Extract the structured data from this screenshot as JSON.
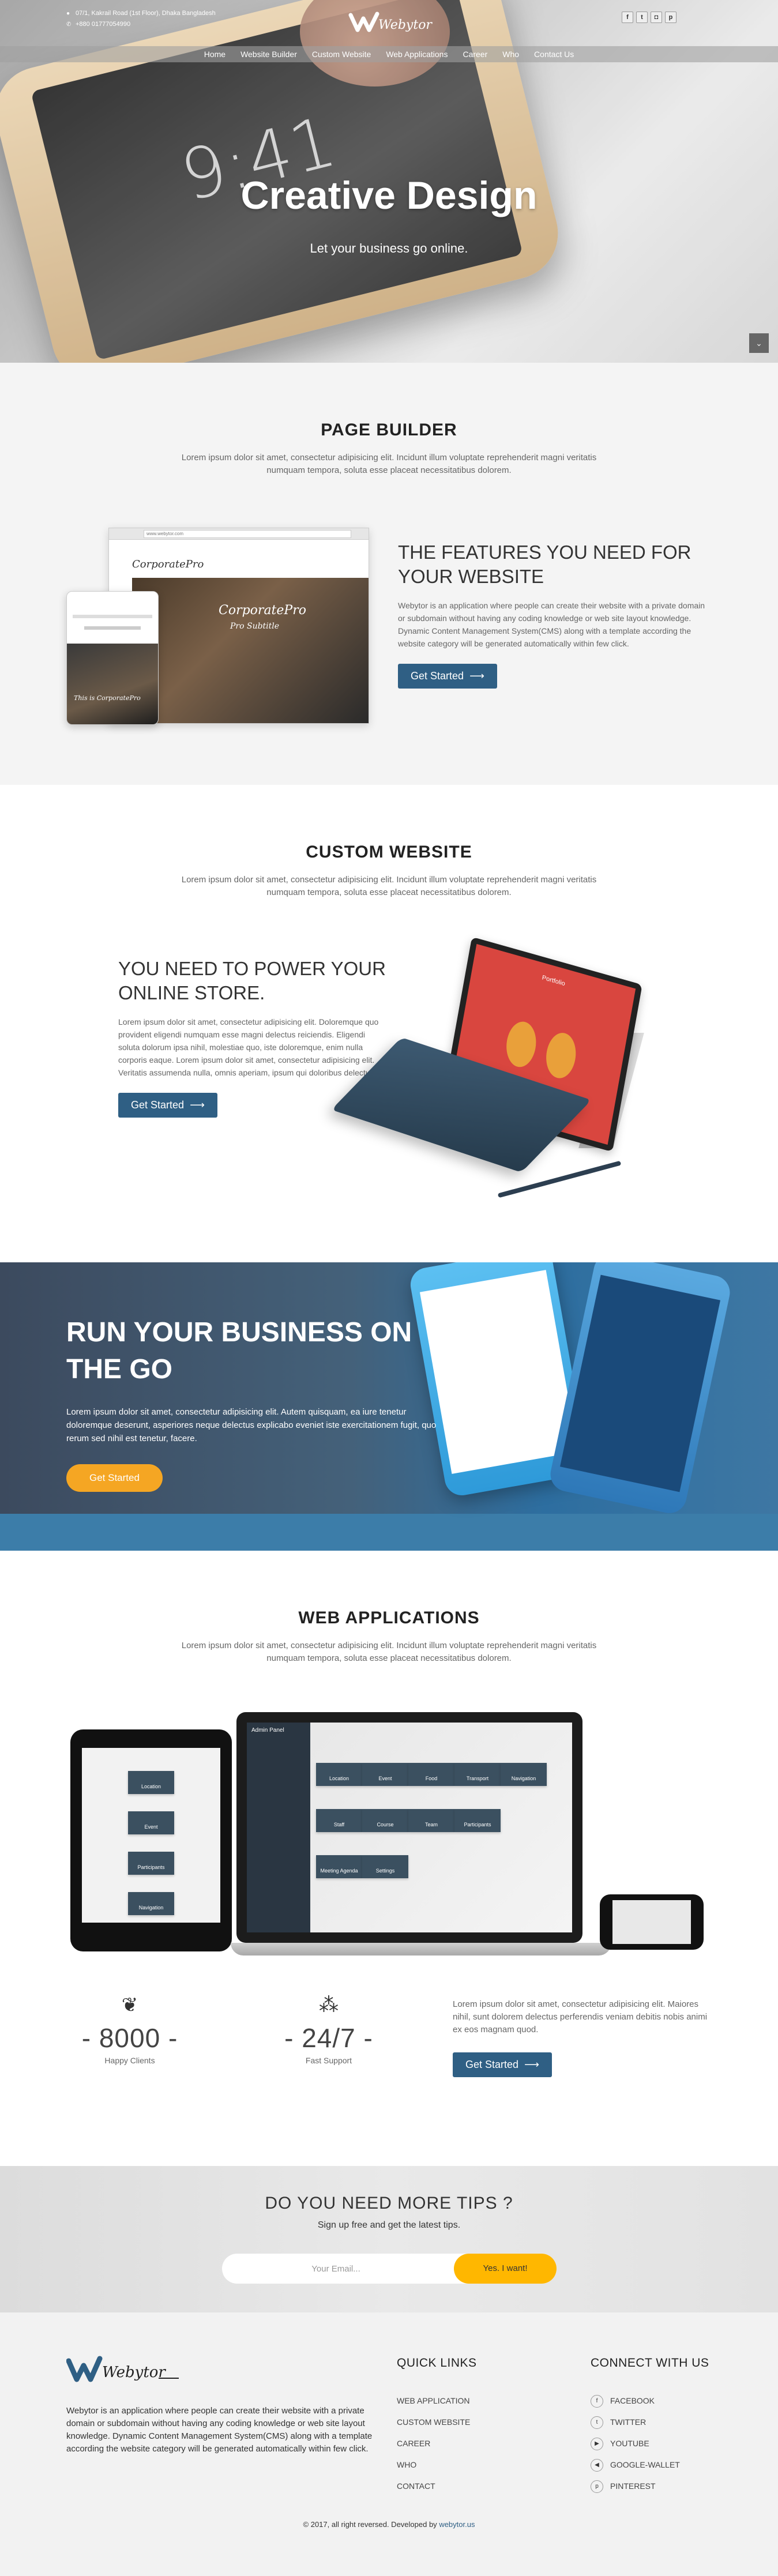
{
  "topbar": {
    "address": "07/1, Kakrail Road (1st Floor), Dhaka Bangladesh",
    "phone": "+880 01777054990",
    "socials": [
      {
        "icon": "facebook-icon",
        "glyph": "f"
      },
      {
        "icon": "twitter-icon",
        "glyph": "t"
      },
      {
        "icon": "instagram-icon",
        "glyph": "◘"
      },
      {
        "icon": "pinterest-icon",
        "glyph": "p"
      }
    ]
  },
  "brand": {
    "name": "Webytor"
  },
  "nav": [
    "Home",
    "Website Builder",
    "Custom Website",
    "Web Applications",
    "Career",
    "Who",
    "Contact Us"
  ],
  "hero": {
    "title": "Creative Design",
    "subtitle": "Let your business go online."
  },
  "page_builder": {
    "title": "PAGE BUILDER",
    "lead": "Lorem ipsum dolor sit amet, consectetur adipisicing elit. Incidunt illum voluptate reprehenderit magni veritatis numquam tempora, soluta esse placeat necessitatibus dolorem.",
    "feature_heading": "THE FEATURES YOU NEED FOR YOUR WEBSITE",
    "feature_text": "Webytor is an application where people can create their website with a private domain or subdomain without having any coding knowledge or web site layout knowledge. Dynamic Content Management System(CMS) along with a template according the website category will be generated automatically within few click.",
    "button": "Get Started",
    "mock_url": "www.webytor.com",
    "mock_brand": "CorporatePro",
    "mock_tagline": "Pro Subtitle",
    "mock_mobile_caption": "This is CorporatePro"
  },
  "custom_website": {
    "title": "CUSTOM WEBSITE",
    "lead": "Lorem ipsum dolor sit amet, consectetur adipisicing elit. Incidunt illum voluptate reprehenderit magni veritatis numquam tempora, soluta esse placeat necessitatibus dolorem.",
    "heading": "YOU NEED TO POWER YOUR ONLINE STORE.",
    "text": "Lorem ipsum dolor sit amet, consectetur adipisicing elit. Doloremque quo provident eligendi numquam esse magni delectus reiciendis. Eligendi soluta dolorum ipsa nihil, molestiae quo, iste doloremque, enim nulla corporis eaque. Lorem ipsum dolor sit amet, consectetur adipisicing elit. Veritatis assumenda nulla, omnis aperiam, ipsum qui doloribus delectus.",
    "button": "Get Started",
    "screen_label": "Portfolio"
  },
  "run_business": {
    "heading": "RUN YOUR BUSINESS ON THE GO",
    "text": "Lorem ipsum dolor sit amet, consectetur adipisicing elit. Autem quisquam, ea iure tenetur doloremque deserunt, asperiores neque delectus explicabo eveniet iste exercitationem fugit, quo rerum sed nihil est tenetur, facere.",
    "button": "Get Started"
  },
  "web_apps": {
    "title": "WEB APPLICATIONS",
    "lead": "Lorem ipsum dolor sit amet, consectetur adipisicing elit. Incidunt illum voluptate reprehenderit magni veritatis numquam tempora, soluta esse placeat necessitatibus dolorem.",
    "panel_title": "Admin Panel",
    "tiles": [
      "Location",
      "Event",
      "Food",
      "Transport",
      "Navigation",
      "Staff",
      "Course",
      "Team",
      "Participants",
      "Meeting Agenda",
      "Settings"
    ],
    "tablet_tiles": [
      "Location",
      "Event",
      "Participants",
      "Navigation"
    ],
    "stats": [
      {
        "icon": "leaf-icon",
        "glyph": "❦",
        "value": "- 8000 -",
        "label": "Happy Clients"
      },
      {
        "icon": "dots-icon",
        "glyph": "⁂",
        "value": "- 24/7 -",
        "label": "Fast Support"
      }
    ],
    "text": "Lorem ipsum dolor sit amet, consectetur adipisicing elit. Maiores nihil, sunt dolorem delectus perferendis veniam debitis nobis animi ex eos magnam quod.",
    "button": "Get Started"
  },
  "tips": {
    "title": "DO YOU NEED MORE TIPS ?",
    "subtitle": "Sign up free and get the latest tips.",
    "email_placeholder": "Your Email...",
    "button": "Yes. I want!"
  },
  "footer": {
    "about": "Webytor is an application where people can create their website with a private domain or subdomain without having any coding knowledge or web site layout knowledge. Dynamic Content Management System(CMS) along with a template according the website category will be generated automatically within few click.",
    "quick_links_title": "QUICK LINKS",
    "quick_links": [
      "WEB APPLICATION",
      "CUSTOM WEBSITE",
      "CAREER",
      "WHO",
      "CONTACT"
    ],
    "connect_title": "CONNECT WITH US",
    "connect": [
      {
        "icon": "facebook-icon",
        "glyph": "f",
        "label": "FACEBOOK"
      },
      {
        "icon": "twitter-icon",
        "glyph": "t",
        "label": "TWITTER"
      },
      {
        "icon": "youtube-icon",
        "glyph": "▶",
        "label": "YOUTUBE"
      },
      {
        "icon": "google-wallet-icon",
        "glyph": "◀",
        "label": "GOOGLE-WALLET"
      },
      {
        "icon": "pinterest-icon",
        "glyph": "p",
        "label": "PINTEREST"
      }
    ],
    "copyright": "© 2017, all right reversed. Developed by",
    "developer": "webytor.us"
  },
  "colors": {
    "primary": "#2f5f84",
    "accent": "#f5a623",
    "tips_button": "#ffb700"
  }
}
